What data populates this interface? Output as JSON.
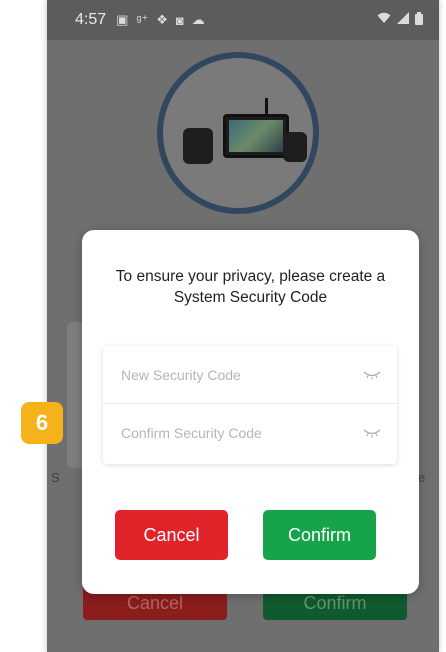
{
  "status_bar": {
    "time": "4:57",
    "icons_left": [
      "image-icon",
      "signal-text-icon",
      "dropbox-icon",
      "calendar-icon",
      "cloud-icon"
    ],
    "icons_right": [
      "wifi-icon",
      "cell-signal-icon",
      "battery-icon"
    ]
  },
  "background": {
    "left_fragment": "S",
    "right_fragment": "e",
    "cancel_label": "Cancel",
    "confirm_label": "Confirm"
  },
  "dialog": {
    "message": "To ensure your privacy, please create a\nSystem Security Code",
    "new_code_placeholder": "New Security Code",
    "confirm_code_placeholder": "Confirm Security Code",
    "cancel_label": "Cancel",
    "confirm_label": "Confirm",
    "colors": {
      "cancel": "#e0242a",
      "confirm": "#17a34a"
    }
  },
  "step_badge": {
    "number": "6",
    "color": "#f6b21a"
  }
}
